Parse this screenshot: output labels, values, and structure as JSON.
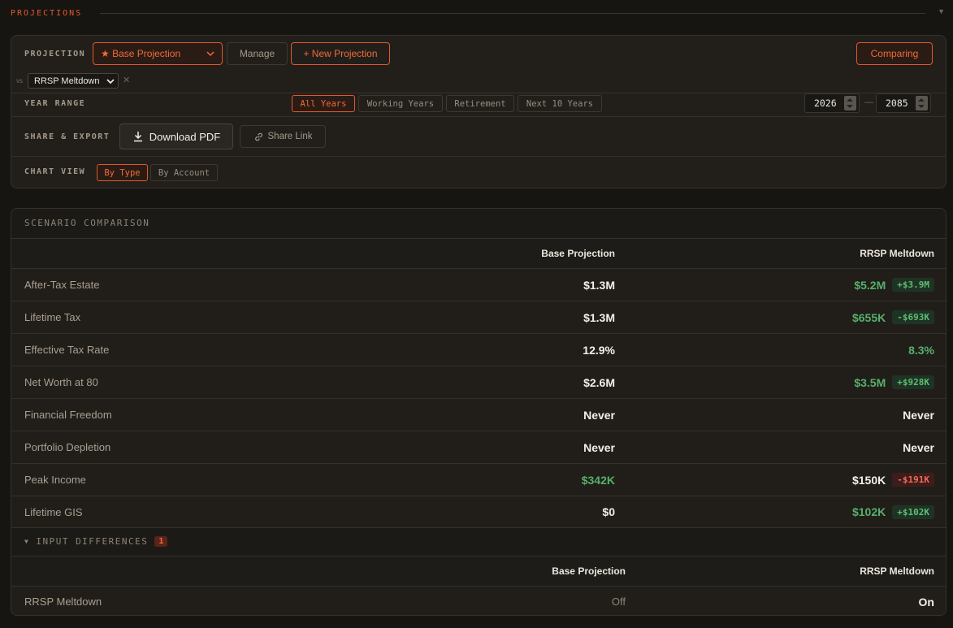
{
  "section": {
    "title": "PROJECTIONS",
    "caret": "▼"
  },
  "controls": {
    "projection_label": "PROJECTION",
    "projection_selected": "★ Base Projection",
    "manage_label": "Manage",
    "new_label": "+ New Projection",
    "comparing_label": "Comparing",
    "vs_label": "vs",
    "vs_selected": "RRSP Meltdown",
    "vs_close": "✕",
    "year_range_label": "YEAR RANGE",
    "year_chips": [
      "All Years",
      "Working Years",
      "Retirement",
      "Next 10 Years"
    ],
    "year_chip_active": "All Years",
    "year_start": "2026",
    "year_end": "2085",
    "year_dash": "—",
    "share_label": "SHARE & EXPORT",
    "download_label": "Download PDF",
    "share_link_label": "Share Link",
    "chart_view_label": "CHART VIEW",
    "chart_view_options": [
      "By Type",
      "By Account"
    ],
    "chart_view_active": "By Type"
  },
  "comparison": {
    "title": "SCENARIO COMPARISON",
    "col_base": "Base Projection",
    "col_alt": "RRSP Meltdown",
    "rows": [
      {
        "label": "After-Tax Estate",
        "base": "$1.3M",
        "alt": "$5.2M",
        "delta": "+$3.9M"
      },
      {
        "label": "Lifetime Tax",
        "base": "$1.3M",
        "alt": "$655K",
        "delta": "-$693K"
      },
      {
        "label": "Effective Tax Rate",
        "base": "12.9%",
        "alt": "8.3%",
        "delta": ""
      },
      {
        "label": "Net Worth at 80",
        "base": "$2.6M",
        "alt": "$3.5M",
        "delta": "+$928K"
      },
      {
        "label": "Financial Freedom",
        "base": "Never",
        "alt": "Never",
        "delta": ""
      },
      {
        "label": "Portfolio Depletion",
        "base": "Never",
        "alt": "Never",
        "delta": ""
      },
      {
        "label": "Peak Income",
        "base": "$342K",
        "alt": "$150K",
        "delta": "-$191K"
      },
      {
        "label": "Lifetime GIS",
        "base": "$0",
        "alt": "$102K",
        "delta": "+$102K"
      }
    ],
    "input_diff_caret": "▼",
    "input_diff_title": "INPUT DIFFERENCES",
    "input_diff_count": "1",
    "input_rows": [
      {
        "label": "RRSP Meltdown",
        "base": "Off",
        "alt": "On"
      }
    ]
  },
  "colors": {
    "accent": "#e0592b",
    "positive": "#56b06a",
    "negative": "#e25a4a",
    "background": "#171512"
  },
  "icons": {
    "download": "download-icon",
    "share": "link-icon",
    "chevron": "chevron-down-icon"
  }
}
